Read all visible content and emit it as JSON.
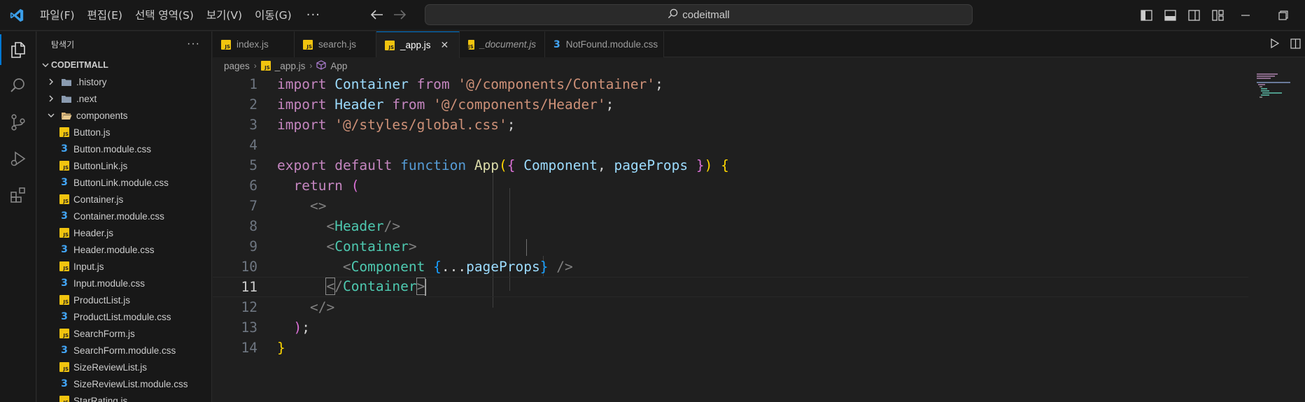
{
  "window": {
    "search_text": "codeitmall"
  },
  "menu": [
    {
      "label": "파일(F)"
    },
    {
      "label": "편집(E)"
    },
    {
      "label": "선택 영역(S)"
    },
    {
      "label": "보기(V)"
    },
    {
      "label": "이동(G)"
    },
    {
      "label": "···"
    }
  ],
  "sidebar": {
    "title": "탐색기",
    "more": "···",
    "root": "CODEITMALL",
    "items": [
      {
        "label": ".history",
        "type": "folder"
      },
      {
        "label": ".next",
        "type": "folder"
      },
      {
        "label": "components",
        "type": "folder-open"
      },
      {
        "label": "Button.js",
        "type": "js"
      },
      {
        "label": "Button.module.css",
        "type": "css"
      },
      {
        "label": "ButtonLink.js",
        "type": "js"
      },
      {
        "label": "ButtonLink.module.css",
        "type": "css"
      },
      {
        "label": "Container.js",
        "type": "js"
      },
      {
        "label": "Container.module.css",
        "type": "css"
      },
      {
        "label": "Header.js",
        "type": "js"
      },
      {
        "label": "Header.module.css",
        "type": "css"
      },
      {
        "label": "Input.js",
        "type": "js"
      },
      {
        "label": "Input.module.css",
        "type": "css"
      },
      {
        "label": "ProductList.js",
        "type": "js"
      },
      {
        "label": "ProductList.module.css",
        "type": "css"
      },
      {
        "label": "SearchForm.js",
        "type": "js"
      },
      {
        "label": "SearchForm.module.css",
        "type": "css"
      },
      {
        "label": "SizeReviewList.js",
        "type": "js"
      },
      {
        "label": "SizeReviewList.module.css",
        "type": "css"
      },
      {
        "label": "StarRating.js",
        "type": "js"
      }
    ]
  },
  "tabs": [
    {
      "label": "index.js",
      "type": "js"
    },
    {
      "label": "search.js",
      "type": "js"
    },
    {
      "label": "_app.js",
      "type": "js",
      "close": "✕"
    },
    {
      "label": "_document.js",
      "type": "js"
    },
    {
      "label": "NotFound.module.css",
      "type": "css"
    }
  ],
  "breadcrumb": {
    "folder": "pages",
    "file": "_app.js",
    "symbol": "App"
  },
  "editor": {
    "line_numbers": [
      "1",
      "2",
      "3",
      "4",
      "5",
      "6",
      "7",
      "8",
      "9",
      "10",
      "11",
      "12",
      "13",
      "14"
    ],
    "current_line": "11"
  },
  "colors": {
    "accent": "#0078d4",
    "js_icon": "#f1c40f",
    "css_icon": "#42a5f5"
  }
}
